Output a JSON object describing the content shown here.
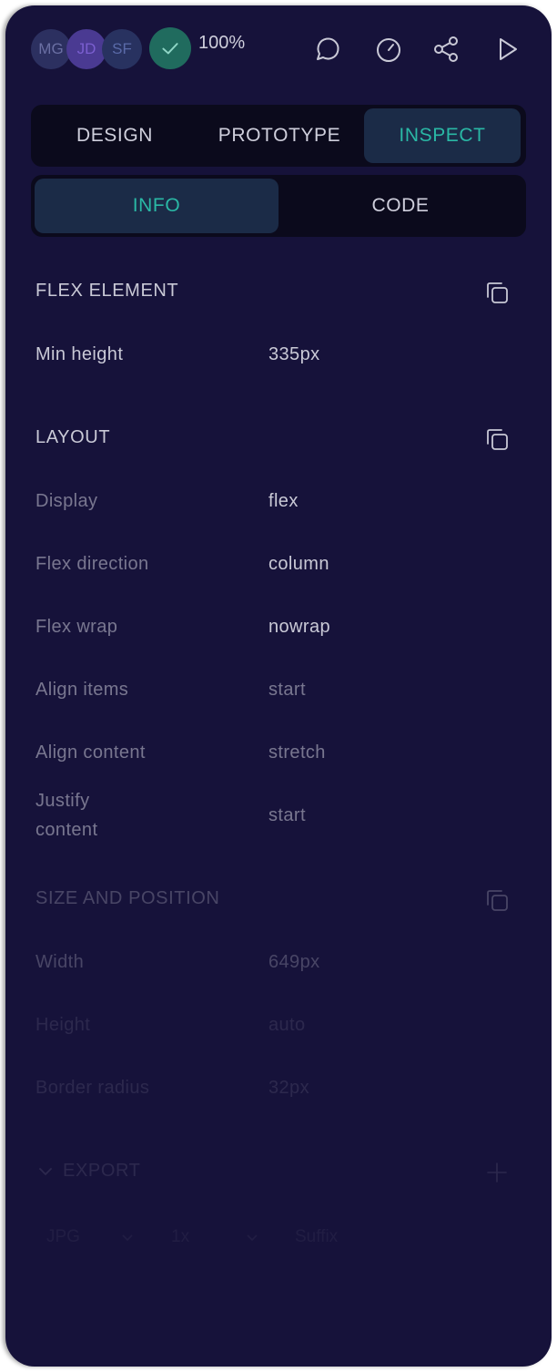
{
  "header": {
    "collaborators": [
      {
        "initials": "MG"
      },
      {
        "initials": "JD"
      },
      {
        "initials": "SF"
      }
    ],
    "zoom": "100%",
    "icons": [
      "comment-icon",
      "stopwatch-icon",
      "share-icon",
      "play-icon"
    ]
  },
  "tabs": {
    "main": [
      {
        "label": "DESIGN"
      },
      {
        "label": "PROTOTYPE"
      },
      {
        "label": "INSPECT",
        "active": true
      }
    ],
    "sub": [
      {
        "label": "INFO",
        "active": true
      },
      {
        "label": "CODE"
      }
    ]
  },
  "sections": {
    "flex_element": {
      "title": "FLEX ELEMENT",
      "props": [
        {
          "label": "Min height",
          "value": "335px"
        }
      ]
    },
    "layout": {
      "title": "LAYOUT",
      "props": [
        {
          "label": "Display",
          "value": "flex"
        },
        {
          "label": "Flex direction",
          "value": "column"
        },
        {
          "label": "Flex wrap",
          "value": "nowrap"
        },
        {
          "label": "Align items",
          "value": "start"
        },
        {
          "label": "Align content",
          "value": "stretch"
        },
        {
          "label": "Justify content",
          "value": "start"
        }
      ]
    },
    "size_position": {
      "title": "SIZE AND POSITION",
      "props": [
        {
          "label": "Width",
          "value": "649px"
        },
        {
          "label": "Height",
          "value": "auto"
        },
        {
          "label": "Border radius",
          "value": "32px"
        }
      ]
    },
    "export": {
      "title": "EXPORT",
      "format": "JPG",
      "scale": "1x",
      "suffix_placeholder": "Suffix"
    }
  },
  "colors": {
    "panel_bg": "#16123a",
    "tab_bg": "#0b0a1c",
    "active_tab_bg": "#1b2b47",
    "accent": "#2ab8a5"
  }
}
